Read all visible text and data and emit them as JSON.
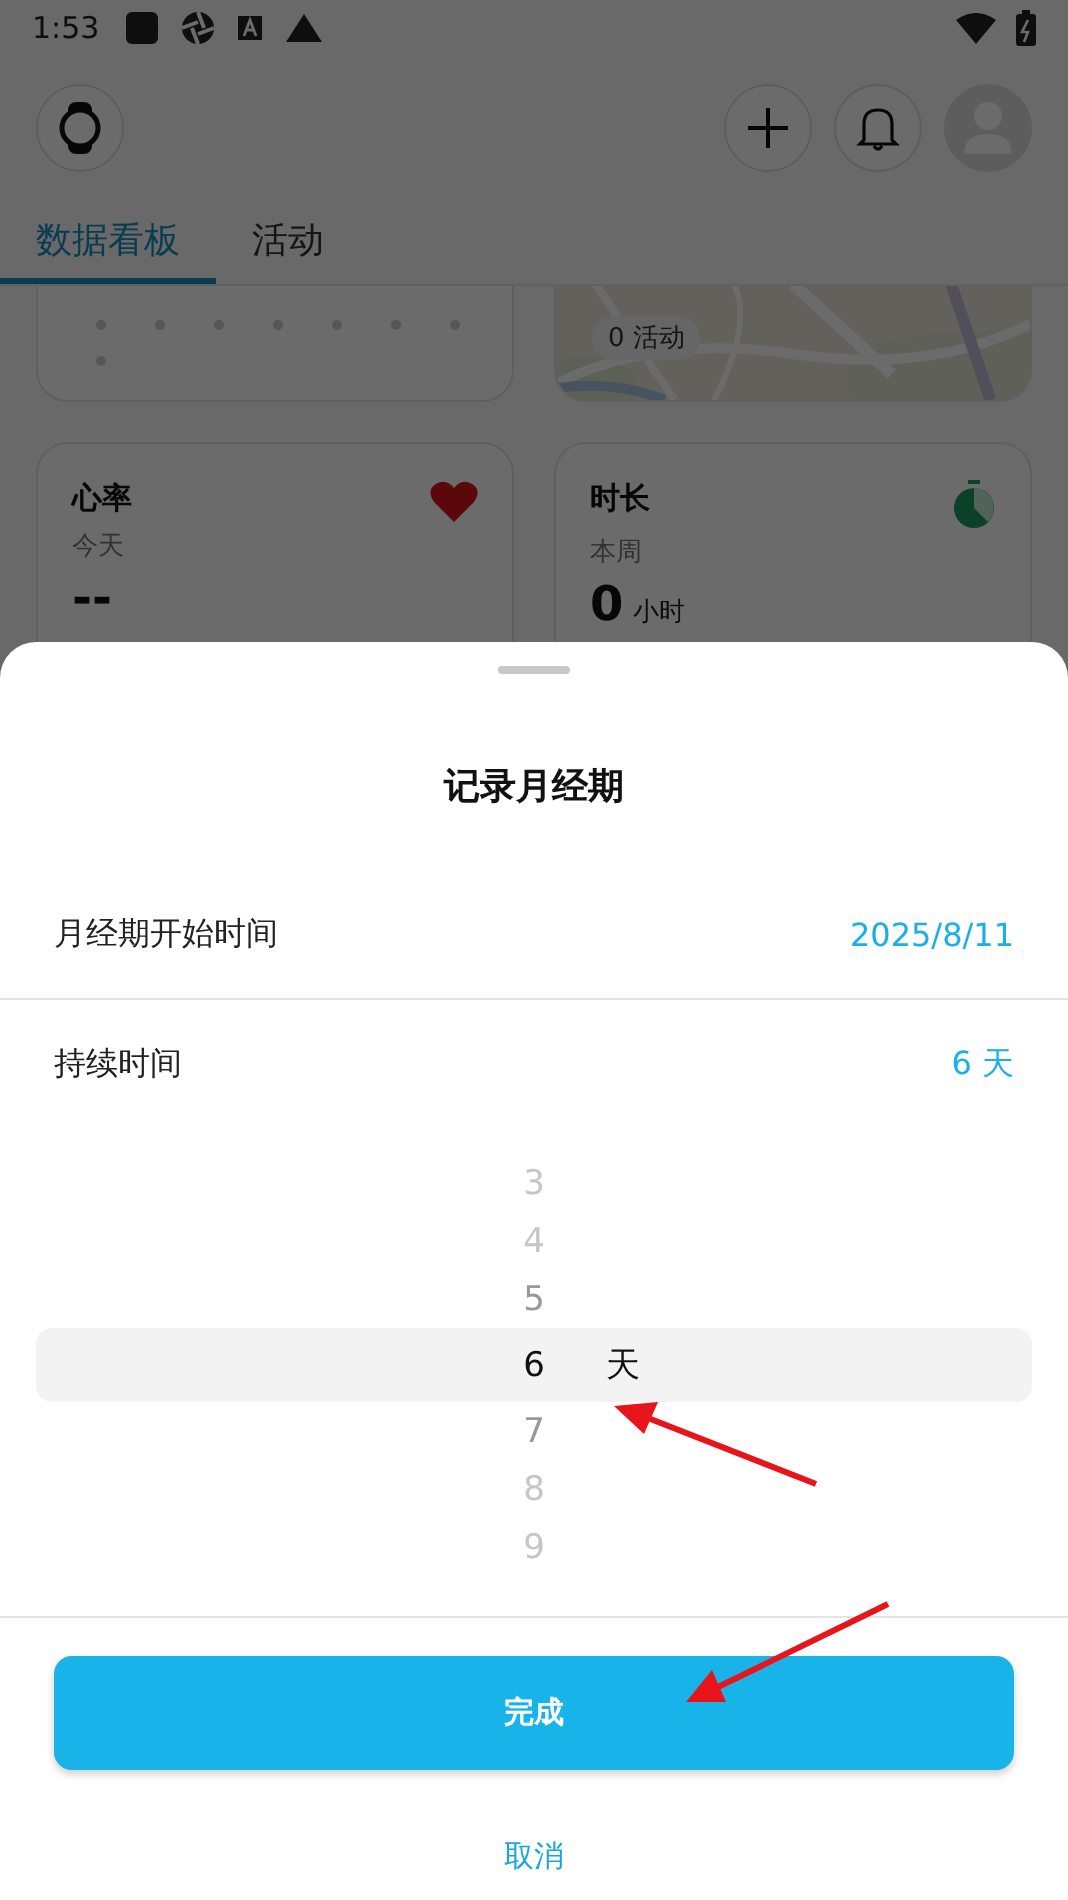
{
  "status_bar": {
    "time": "1:53"
  },
  "tabs": [
    {
      "label": "数据看板",
      "selected": true
    },
    {
      "label": "活动",
      "selected": false
    }
  ],
  "map_card": {
    "badge": "0 活动"
  },
  "cards": [
    {
      "kind": "heart",
      "title": "心率",
      "subtitle": "今天",
      "value": "--"
    },
    {
      "kind": "timer",
      "title": "时长",
      "subtitle": "本周",
      "value": "0",
      "unit": "小时"
    }
  ],
  "sheet": {
    "title": "记录月经期",
    "rows": [
      {
        "label": "月经期开始时间",
        "value": "2025/8/11"
      },
      {
        "label": "持续时间",
        "value": "6 天"
      }
    ],
    "picker": {
      "unit": "天",
      "options": [
        {
          "label": "3",
          "selected": false
        },
        {
          "label": "4",
          "selected": false
        },
        {
          "label": "5",
          "selected": false
        },
        {
          "label": "6",
          "selected": true
        },
        {
          "label": "7",
          "selected": false
        },
        {
          "label": "8",
          "selected": false
        },
        {
          "label": "9",
          "selected": false
        }
      ]
    },
    "confirm": "完成",
    "cancel": "取消"
  }
}
